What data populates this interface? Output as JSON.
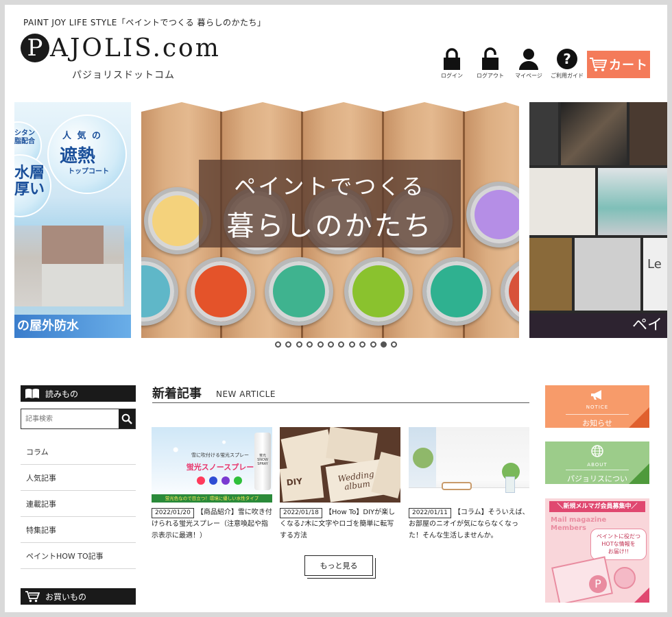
{
  "header": {
    "tagline": "PAINT JOY LIFE STYLE「ペイントでつくる 暮らしのかたち」",
    "logo_initial": "P",
    "logo_rest": "AJOLIS.com",
    "logo_kana": "パジョリスドットコム",
    "icons": [
      {
        "label": "ログイン",
        "icon": "lock-icon"
      },
      {
        "label": "ログアウト",
        "icon": "unlock-icon"
      },
      {
        "label": "マイページ",
        "icon": "user-icon"
      },
      {
        "label": "ご利用ガイド",
        "icon": "help-icon"
      }
    ],
    "cart_label": "カート",
    "cart_color": "#f47b5a"
  },
  "slider": {
    "left": {
      "line1": "シタン\n脂配合",
      "line2": "人 気 の",
      "line3": "遮熱",
      "line4": "トップコート",
      "line5": "水層\n厚い",
      "bottom": "の屋外防水"
    },
    "main": {
      "title_line1": "ペイントでつくる",
      "title_line2": "暮らしのかたち"
    },
    "right": {
      "bottom": "ペイ",
      "side_text": "Le"
    },
    "dots_count": 12,
    "active_dot": 10
  },
  "sidebar": {
    "reading_title": "読みもの",
    "search_placeholder": "記事検索",
    "items": [
      "コラム",
      "人気記事",
      "連載記事",
      "特集記事",
      "ペイントHOW TO記事"
    ],
    "shopping_title": "お買いもの"
  },
  "main": {
    "section_title": "新着記事",
    "section_sub": "NEW ARTICLE",
    "articles": [
      {
        "date": "2022/01/20",
        "text": "【商品紹介】雪に吹き付けられる蛍光スプレー（注意喚起や指示表示に最適！）",
        "img_label1": "雪に吹付ける蛍光スプレー",
        "img_label2": "蛍光スノースプレー",
        "img_label3": "蛍光色なので目立つ！環境に優しい水性タイプ",
        "can_label": "蛍光 SNOW SPRAY"
      },
      {
        "date": "2022/01/18",
        "text": "【How To】DIYが楽しくなる♪木に文字やロゴを簡単に転写する方法",
        "img_label1": "DIY",
        "img_label2": "Wedding album"
      },
      {
        "date": "2022/01/11",
        "text": "【コラム】そういえば、お部屋のニオイが気にならなくなった！そんな生活しませんか。"
      }
    ],
    "more_label": "もっと見る"
  },
  "right": {
    "notice_en": "NOTICE",
    "notice_jp": "お知らせ",
    "notice_color": "#f79b6a",
    "about_en": "ABOUT",
    "about_jp": "パジョリスについて",
    "about_color": "#9ccc8a",
    "mail_header": "＼新規メルマガ会員募集中／",
    "mail_en": "Mail magazine\nMembers",
    "mail_bubble": "ペイントに役だつ\nHOTな情報を\nお届け!!",
    "mail_p": "P"
  }
}
